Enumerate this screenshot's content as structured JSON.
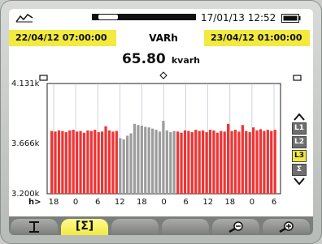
{
  "status": {
    "datetime": "17/01/13 12:52",
    "left_icon": "waveform-icon",
    "meter_icon": "recording-progress-icon",
    "battery_icon": "battery-icon"
  },
  "range": {
    "start": "22/04/12 07:00:00",
    "mode": "VARh",
    "end": "23/04/12 01:00:00"
  },
  "reading": {
    "value": "65.80",
    "unit": "kvarh"
  },
  "chart_data": {
    "type": "bar",
    "ylabels": [
      "4.131k",
      "3.666k",
      "3.200k"
    ],
    "ylim": [
      3200,
      4131
    ],
    "x_prefix": "h>",
    "x_ticks": [
      "18",
      "0",
      "6",
      "12",
      "18",
      "0",
      "6",
      "12",
      "18",
      "0",
      "6"
    ],
    "colors": {
      "normal": "#f03434",
      "highlight": "#9c9c9c",
      "grid": "#aeb9c5"
    },
    "values": [
      3730,
      3725,
      3735,
      3730,
      3720,
      3735,
      3740,
      3725,
      3730,
      3715,
      3735,
      3730,
      3740,
      3720,
      3725,
      3770,
      3735,
      3725,
      3730,
      3670,
      3660,
      3690,
      3710,
      3790,
      3780,
      3775,
      3765,
      3760,
      3750,
      3740,
      3725,
      3815,
      3735,
      3720,
      3730,
      3725,
      3715,
      3735,
      3730,
      3720,
      3740,
      3730,
      3735,
      3720,
      3740,
      3735,
      3715,
      3730,
      3725,
      3790,
      3730,
      3740,
      3725,
      3780,
      3730,
      3720,
      3760,
      3735,
      3745,
      3730,
      3740,
      3730,
      3740
    ],
    "categories_gray_from": 19,
    "categories_gray_to": 34
  },
  "selector": {
    "items": [
      "L1",
      "L2",
      "L3",
      "Σ"
    ],
    "active": "L3"
  },
  "softkeys": [
    {
      "label": "",
      "icon": "cursor-icon",
      "active": false
    },
    {
      "label": "[Σ]",
      "icon": "",
      "active": true
    },
    {
      "label": "",
      "icon": "",
      "active": false
    },
    {
      "label": "",
      "icon": "",
      "active": false
    },
    {
      "label": "",
      "icon": "zoom-out-icon",
      "active": false
    },
    {
      "label": "",
      "icon": "zoom-in-icon",
      "active": false
    }
  ]
}
